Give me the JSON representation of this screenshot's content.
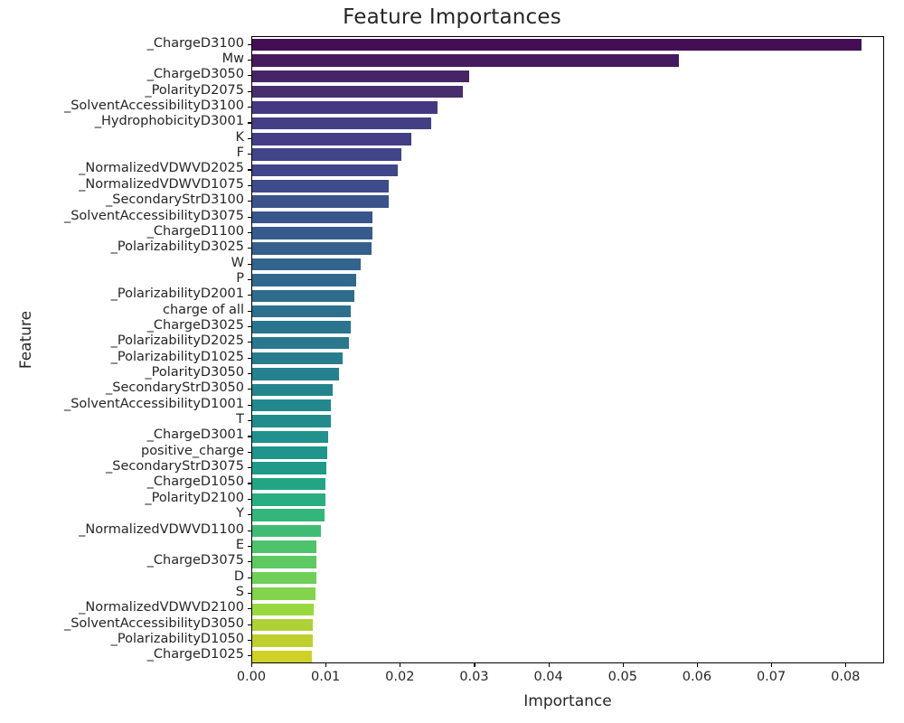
{
  "chart_data": {
    "type": "bar",
    "orientation": "horizontal",
    "title": "Feature Importances",
    "xlabel": "Importance",
    "ylabel": "Feature",
    "xlim": [
      0.0,
      0.0852
    ],
    "grid": false,
    "legend": false,
    "colormap": "viridis",
    "xticks": [
      0.0,
      0.01,
      0.02,
      0.03,
      0.04,
      0.05,
      0.06,
      0.07,
      0.08
    ],
    "xtick_labels": [
      "0.00",
      "0.01",
      "0.02",
      "0.03",
      "0.04",
      "0.05",
      "0.06",
      "0.07",
      "0.08"
    ],
    "categories": [
      "_ChargeD3100",
      "Mw",
      "_ChargeD3050",
      "_PolarityD2075",
      "_SolventAccessibilityD3100",
      "_HydrophobicityD3001",
      "K",
      "F",
      "_NormalizedVDWVD2025",
      "_NormalizedVDWVD1075",
      "_SecondaryStrD3100",
      "_SolventAccessibilityD3075",
      "_ChargeD1100",
      "_PolarizabilityD3025",
      "W",
      "P",
      "_PolarizabilityD2001",
      "charge of all",
      "_ChargeD3025",
      "_PolarizabilityD2025",
      "_PolarizabilityD1025",
      "_PolarityD3050",
      "_SecondaryStrD3050",
      "_SolventAccessibilityD1001",
      "T",
      "_ChargeD3001",
      "positive_charge",
      "_SecondaryStrD3075",
      "_ChargeD1050",
      "_PolarityD2100",
      "Y",
      "_NormalizedVDWVD1100",
      "E",
      "_ChargeD3075",
      "D",
      "S",
      "_NormalizedVDWVD2100",
      "_SolventAccessibilityD3050",
      "_PolarizabilityD1050",
      "_ChargeD1025"
    ],
    "values": [
      0.082,
      0.0575,
      0.0292,
      0.0283,
      0.025,
      0.0241,
      0.0214,
      0.0201,
      0.0196,
      0.0184,
      0.0184,
      0.0162,
      0.0162,
      0.0161,
      0.0146,
      0.014,
      0.0137,
      0.0133,
      0.0133,
      0.013,
      0.0122,
      0.0117,
      0.0108,
      0.0106,
      0.0106,
      0.0102,
      0.0101,
      0.01,
      0.0099,
      0.0098,
      0.0097,
      0.0093,
      0.0087,
      0.0086,
      0.0086,
      0.0085,
      0.0083,
      0.0082,
      0.0081,
      0.008
    ],
    "bar_colors": [
      "#440e54",
      "#461a5e",
      "#472465",
      "#472e6c",
      "#453882",
      "#443f84",
      "#433e85",
      "#414487",
      "#404688",
      "#3e4c8a",
      "#3b528b",
      "#39568c",
      "#375b8d",
      "#355f8d",
      "#32648e",
      "#31688e",
      "#2f6c8e",
      "#2d708e",
      "#2b748e",
      "#2a788e",
      "#287c8e",
      "#26818e",
      "#25848e",
      "#23888e",
      "#228c8d",
      "#21918c",
      "#20958b",
      "#1f9a8a",
      "#21a585",
      "#28ae80",
      "#32b67a",
      "#3fbc73",
      "#4ec36b",
      "#5ec962",
      "#70cf57",
      "#84d44b",
      "#99d83f",
      "#aed136",
      "#bfd02e",
      "#d0d128"
    ]
  }
}
